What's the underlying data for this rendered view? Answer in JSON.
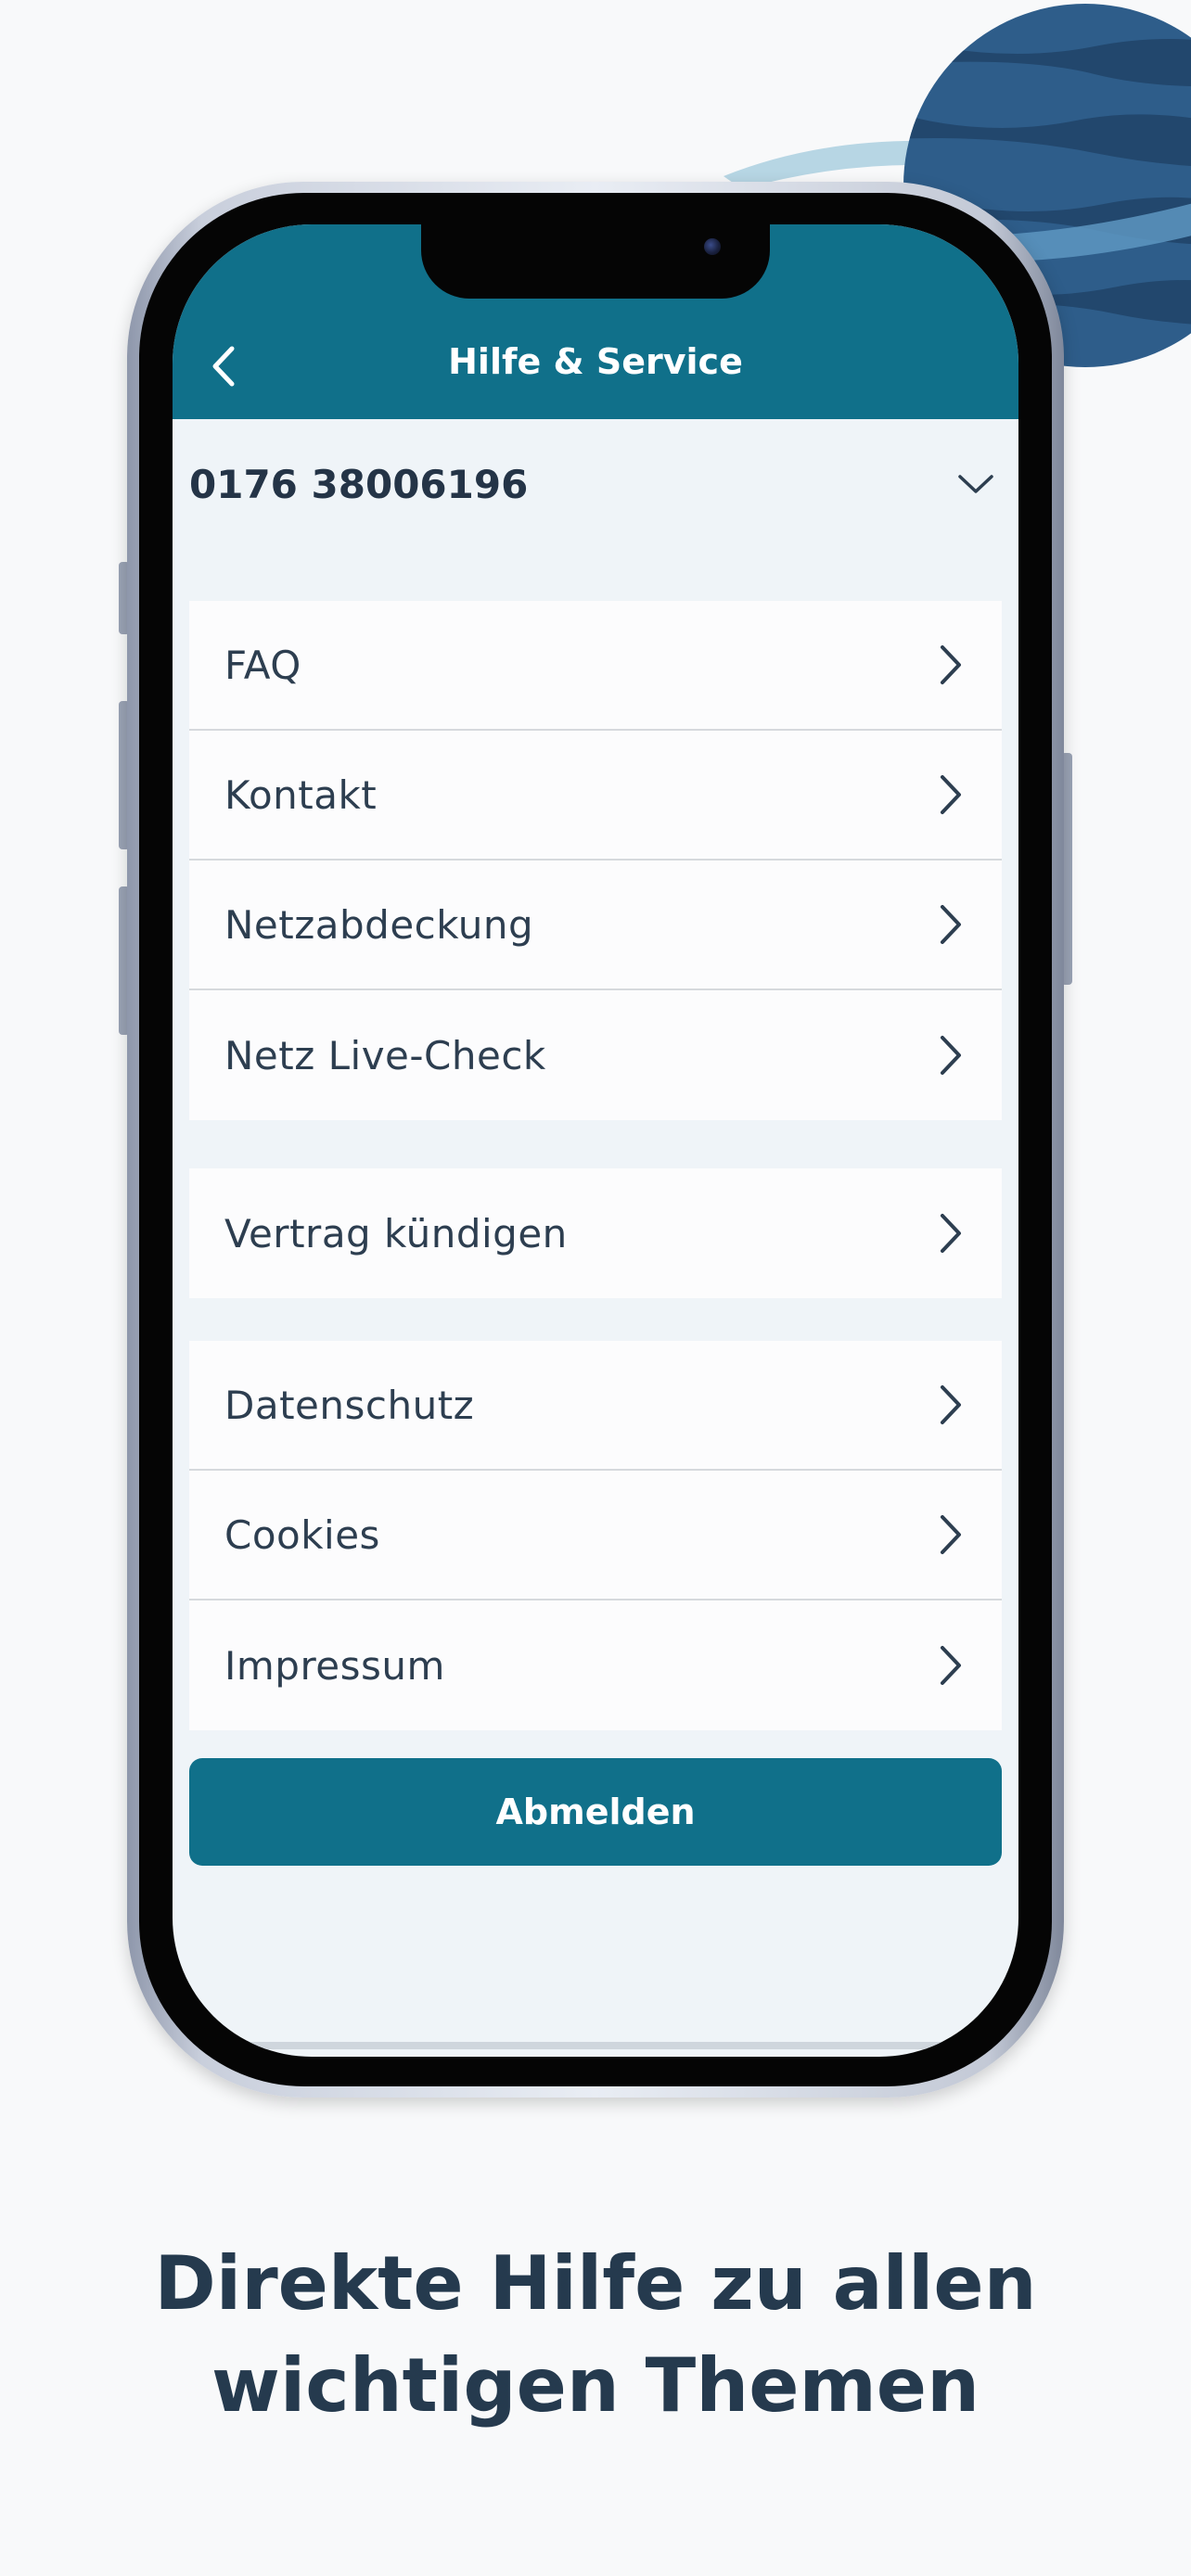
{
  "header": {
    "title": "Hilfe & Service"
  },
  "account": {
    "phone_number": "0176 38006196"
  },
  "menu": {
    "group1": [
      "FAQ",
      "Kontakt",
      "Netzabdeckung",
      "Netz Live-Check"
    ],
    "group2": [
      "Vertrag kündigen"
    ],
    "group3": [
      "Datenschutz",
      "Cookies",
      "Impressum"
    ]
  },
  "buttons": {
    "logout": "Abmelden"
  },
  "caption": {
    "line1": "Direkte Hilfe zu allen",
    "line2": "wichtigen Themen"
  },
  "colors": {
    "accent": "#10708a",
    "text_dark": "#253a4e",
    "background": "#eff4f8"
  },
  "icons": {
    "back": "chevron-left-icon",
    "dropdown": "chevron-down-icon",
    "row": "chevron-right-icon"
  }
}
